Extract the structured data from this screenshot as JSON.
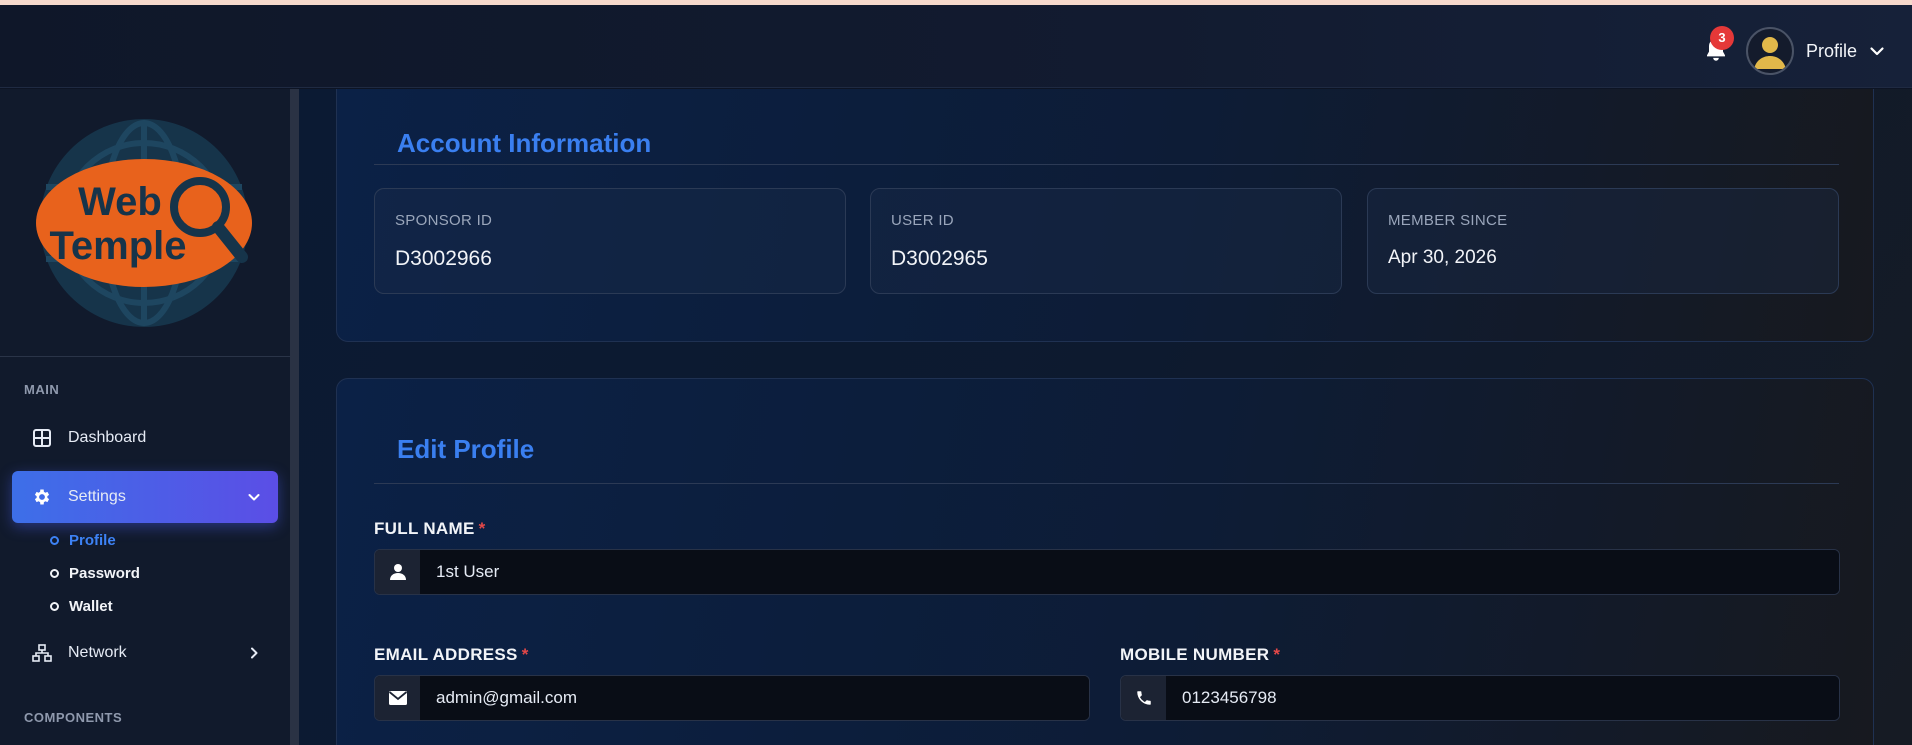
{
  "header": {
    "notification_count": "3",
    "profile_label": "Profile"
  },
  "sidebar": {
    "logo_text_line1": "Web",
    "logo_text_line2": "Temple",
    "sections": {
      "main": "MAIN",
      "components": "COMPONENTS"
    },
    "items": {
      "dashboard": "Dashboard",
      "settings": "Settings",
      "network": "Network"
    },
    "settings_sub": {
      "profile": "Profile",
      "password": "Password",
      "wallet": "Wallet"
    }
  },
  "account_info": {
    "title": "Account Information",
    "sponsor_id_label": "SPONSOR ID",
    "sponsor_id": "D3002966",
    "user_id_label": "USER ID",
    "user_id": "D3002965",
    "member_since_label": "MEMBER SINCE",
    "member_since": "Apr 30, 2026"
  },
  "edit_profile": {
    "title": "Edit Profile",
    "full_name_label": "FULL NAME",
    "full_name": "1st User",
    "email_label": "EMAIL ADDRESS",
    "email": "admin@gmail.com",
    "mobile_label": "MOBILE NUMBER",
    "mobile": "0123456798",
    "required_mark": "*"
  },
  "colors": {
    "accent": "#3a7ff0",
    "active_gradient_start": "#3d6fe8",
    "active_gradient_end": "#5b4ee6",
    "badge": "#e53838",
    "required": "#e54848",
    "logo_orange": "#e8621c",
    "logo_navy": "#16344a"
  }
}
